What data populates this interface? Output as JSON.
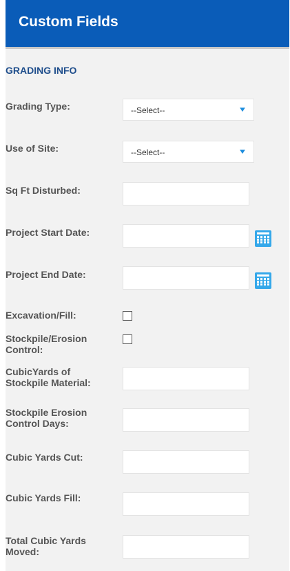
{
  "header": {
    "title": "Custom Fields"
  },
  "section": {
    "title": "GRADING INFO"
  },
  "fields": {
    "grading_type": {
      "label": "Grading Type:",
      "value": "--Select--"
    },
    "use_of_site": {
      "label": "Use of Site:",
      "value": "--Select--"
    },
    "sq_ft_disturbed": {
      "label": "Sq Ft Disturbed:",
      "value": ""
    },
    "project_start_date": {
      "label": "Project Start Date:",
      "value": ""
    },
    "project_end_date": {
      "label": "Project End Date:",
      "value": ""
    },
    "excavation_fill": {
      "label": "Excavation/Fill:",
      "checked": false
    },
    "stockpile_erosion_control": {
      "label": "Stockpile/Erosion Control:",
      "checked": false
    },
    "cubic_yards_stockpile_material": {
      "label": "CubicYards of Stockpile Material:",
      "value": ""
    },
    "stockpile_erosion_control_days": {
      "label": "Stockpile Erosion Control Days:",
      "value": ""
    },
    "cubic_yards_cut": {
      "label": "Cubic Yards Cut:",
      "value": ""
    },
    "cubic_yards_fill": {
      "label": "Cubic Yards Fill:",
      "value": ""
    },
    "total_cubic_yards_moved": {
      "label": "Total Cubic Yards Moved:",
      "value": ""
    }
  },
  "icons": {
    "calendar": "calendar-icon",
    "dropdown": "chevron-down-icon"
  },
  "colors": {
    "header": "#0a5cb8",
    "section_title": "#1f4e8c",
    "accent": "#35a8ea"
  }
}
